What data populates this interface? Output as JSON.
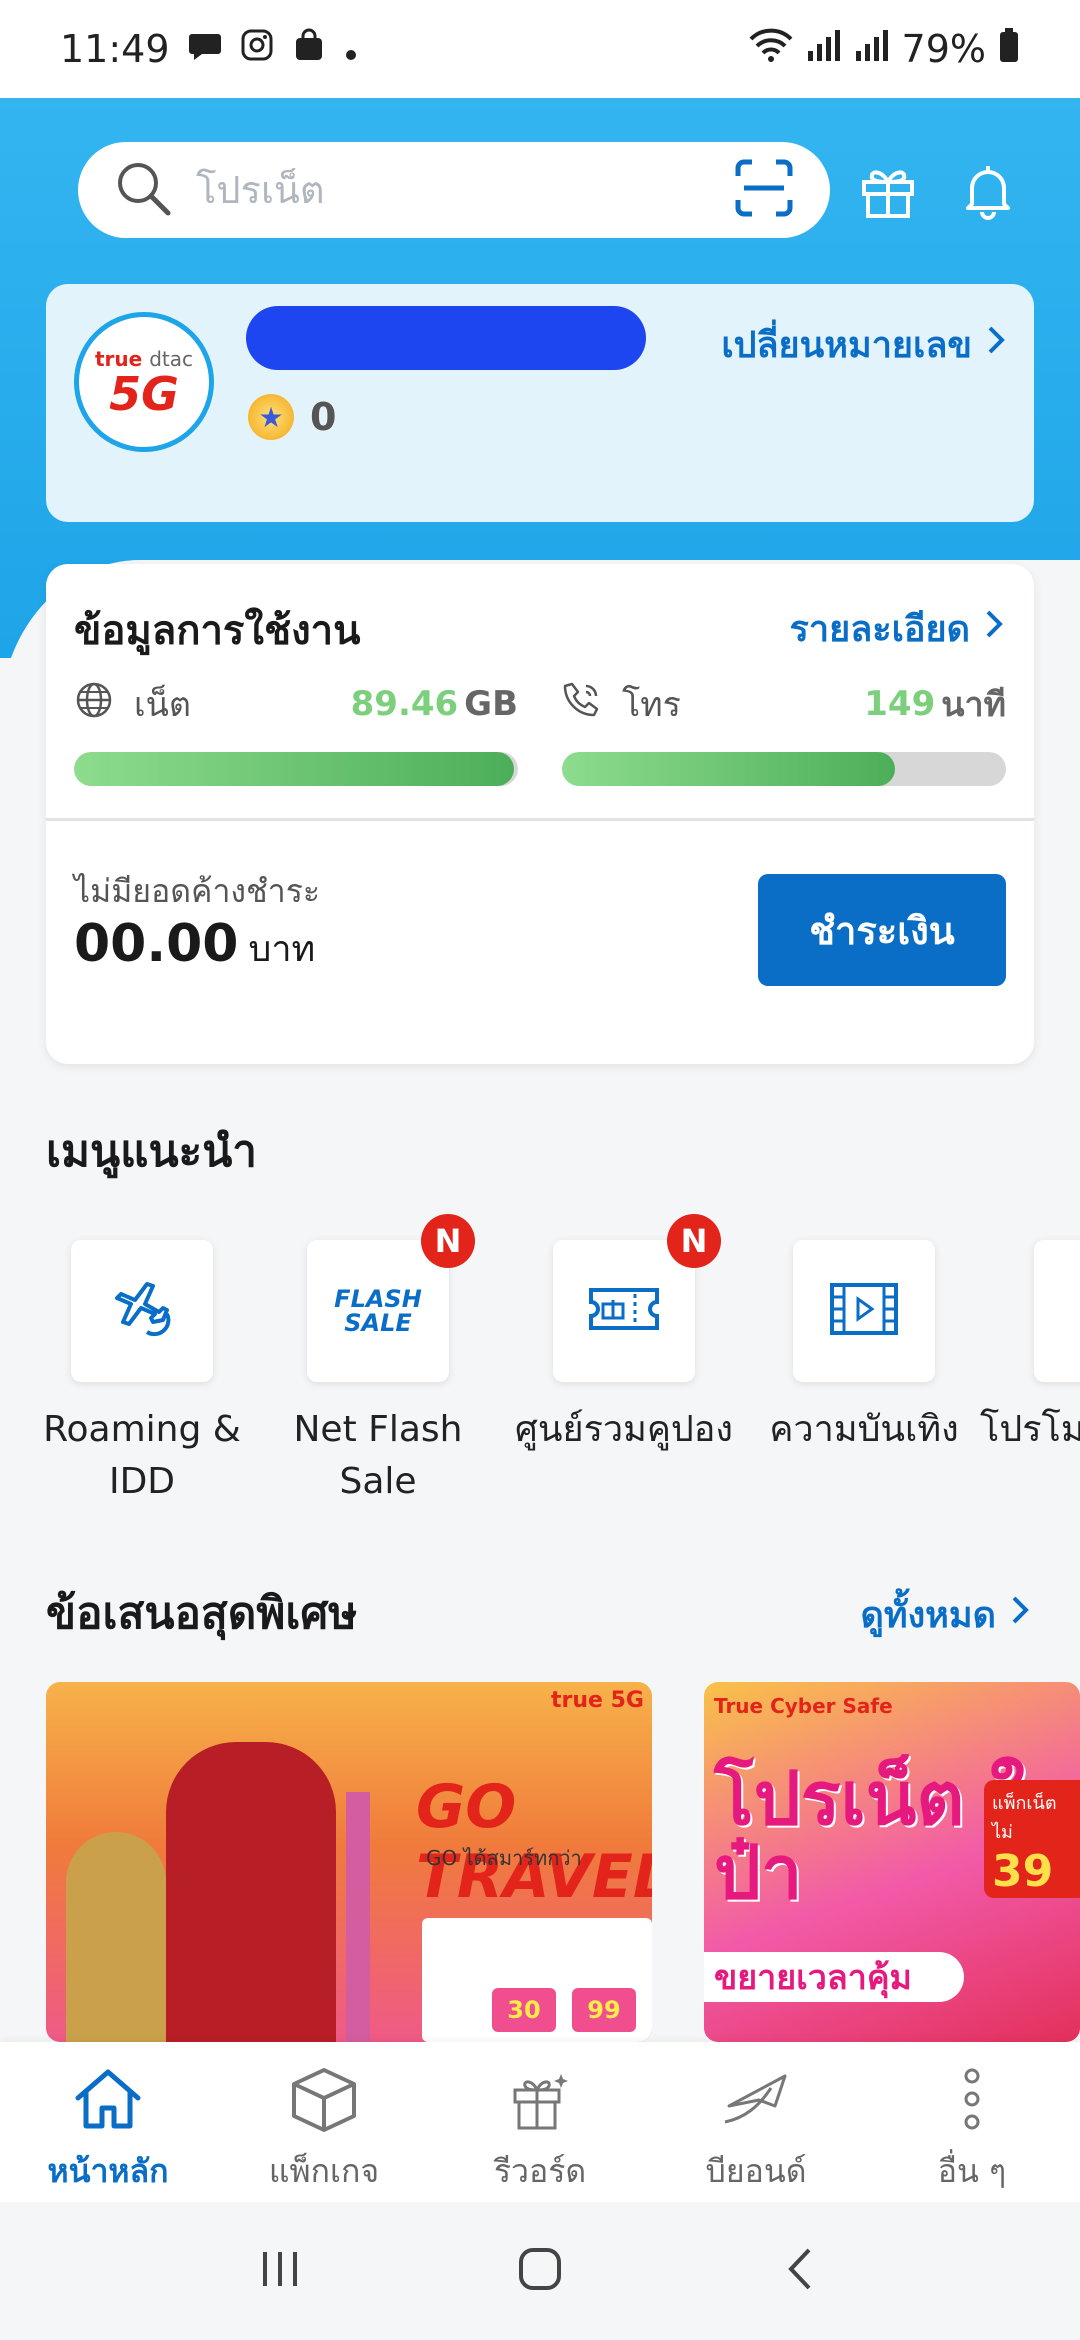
{
  "status_bar": {
    "time": "11:49",
    "battery": "79%"
  },
  "search": {
    "placeholder": "โปรเน็ต"
  },
  "account": {
    "logo_brand": "true",
    "logo_brand2": "dtac",
    "logo_network": "5G",
    "points": "0",
    "change_number_label": "เปลี่ยนหมายเลข"
  },
  "usage": {
    "title": "ข้อมูลการใช้งาน",
    "detail_label": "รายละเอียด",
    "data": {
      "label": "เน็ต",
      "amount": "89.46",
      "unit": "GB",
      "fill_fraction": 0.99
    },
    "voice": {
      "label": "โทร",
      "amount": "149",
      "unit": "นาที",
      "fill_fraction": 0.75
    },
    "due_label": "ไม่มียอดค้างชำระ",
    "due_amount": "00.00",
    "currency": "บาท",
    "pay_label": "ชำระเงิน"
  },
  "recommended": {
    "title": "เมนูแนะนำ",
    "items": [
      {
        "label": "Roaming & IDD",
        "icon": "airplane-globe-icon",
        "badge": ""
      },
      {
        "label": "Net Flash Sale",
        "icon": "flash-sale-icon",
        "badge": "N",
        "icon_text": "FLASH SALE"
      },
      {
        "label": "ศูนย์รวมคูปอง",
        "icon": "coupon-icon",
        "badge": "N"
      },
      {
        "label": "ความบันเทิง",
        "icon": "film-play-icon",
        "badge": ""
      },
      {
        "label": "โปรโม",
        "icon": "promo-icon",
        "badge": ""
      }
    ]
  },
  "offers": {
    "title": "ข้อเสนอสุดพิเศษ",
    "see_all_label": "ดูทั้งหมด",
    "cards": [
      {
        "brand": "true 5G",
        "headline": "GO TRAVEL",
        "sub": "GO ได้สมาร์ทกว่า",
        "chip1": "30",
        "chip2": "99"
      },
      {
        "brand": "True Cyber Safe",
        "headline": "โปรเน็ต ใจป๋า",
        "subline": "ขยายเวลาคุ้ม",
        "price": "39",
        "price_label": "แพ็กเน็ตไม่"
      }
    ]
  },
  "bottom_nav": {
    "items": [
      {
        "label": "หน้าหลัก",
        "icon": "home-icon",
        "active": true
      },
      {
        "label": "แพ็กเกจ",
        "icon": "package-box-icon",
        "active": false
      },
      {
        "label": "รีวอร์ด",
        "icon": "gift-reward-icon",
        "active": false
      },
      {
        "label": "บียอนด์",
        "icon": "beyond-plane-icon",
        "active": false
      },
      {
        "label": "อื่น ๆ",
        "icon": "more-dots-icon",
        "active": false
      }
    ]
  },
  "colors": {
    "brand_blue": "#0a6ec7",
    "header_blue": "#1ea4e8",
    "progress_green": "#4cae59",
    "badge_red": "#e2241b"
  }
}
